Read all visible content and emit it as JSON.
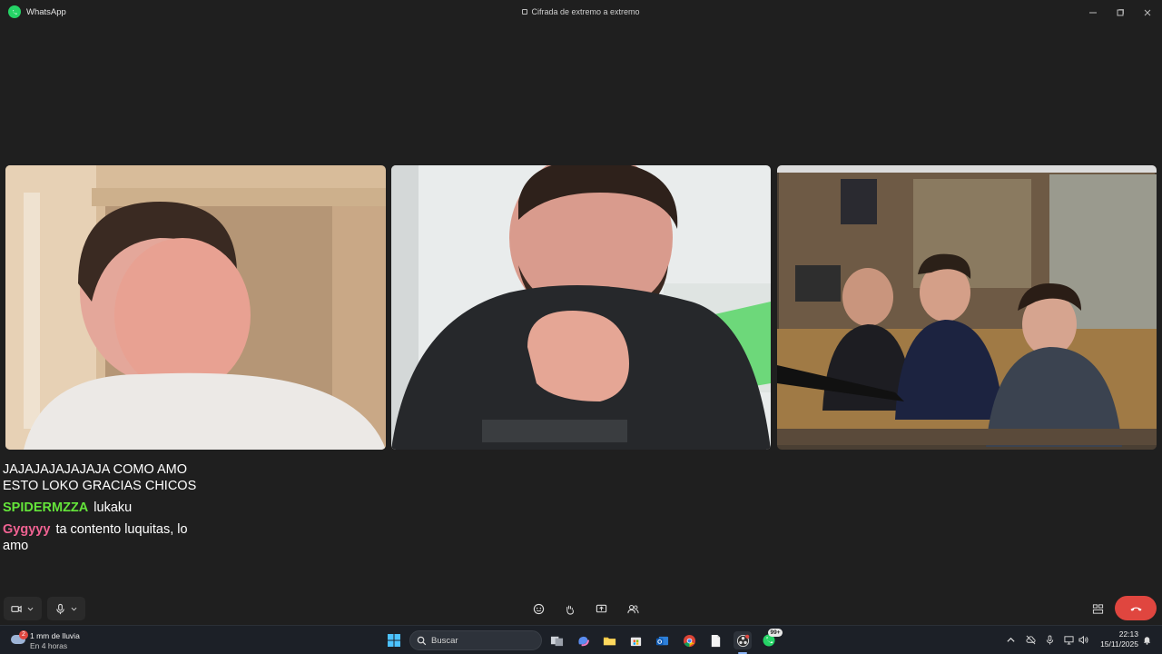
{
  "window": {
    "app_title": "WhatsApp",
    "encryption_label": "Cifrada de extremo a extremo"
  },
  "chat_overlay": {
    "messages": [
      {
        "user": "",
        "text": "JAJAJAJAJAJAJA COMO AMO ESTO LOKO GRACIAS CHICOS",
        "user_color": "#ffffff"
      },
      {
        "user": "SPIDERMZZA",
        "text": "lukaku",
        "user_color": "#64e43a"
      },
      {
        "user": "Gygyyy",
        "text": "ta contento luquitas, lo amo",
        "user_color": "#f06292"
      }
    ]
  },
  "call_controls": {
    "icons": [
      "video-camera-icon",
      "chevron-down-icon",
      "microphone-icon",
      "chevron-down-icon",
      "emoji-icon",
      "raise-hand-icon",
      "share-screen-icon",
      "add-participant-icon",
      "layout-grid-icon",
      "end-call-icon"
    ],
    "end_call_color": "#e0463f"
  },
  "taskbar": {
    "weather_line1": "1 mm de lluvia",
    "weather_line2": "En 4 horas",
    "weather_badge": "2",
    "search_placeholder": "Buscar",
    "whatsapp_badge": "99+",
    "time": "22:13",
    "date": "15/11/2025"
  },
  "colors": {
    "background": "#1f1f1f",
    "taskbar": "#1c2027",
    "whatsapp_green": "#25d366"
  }
}
